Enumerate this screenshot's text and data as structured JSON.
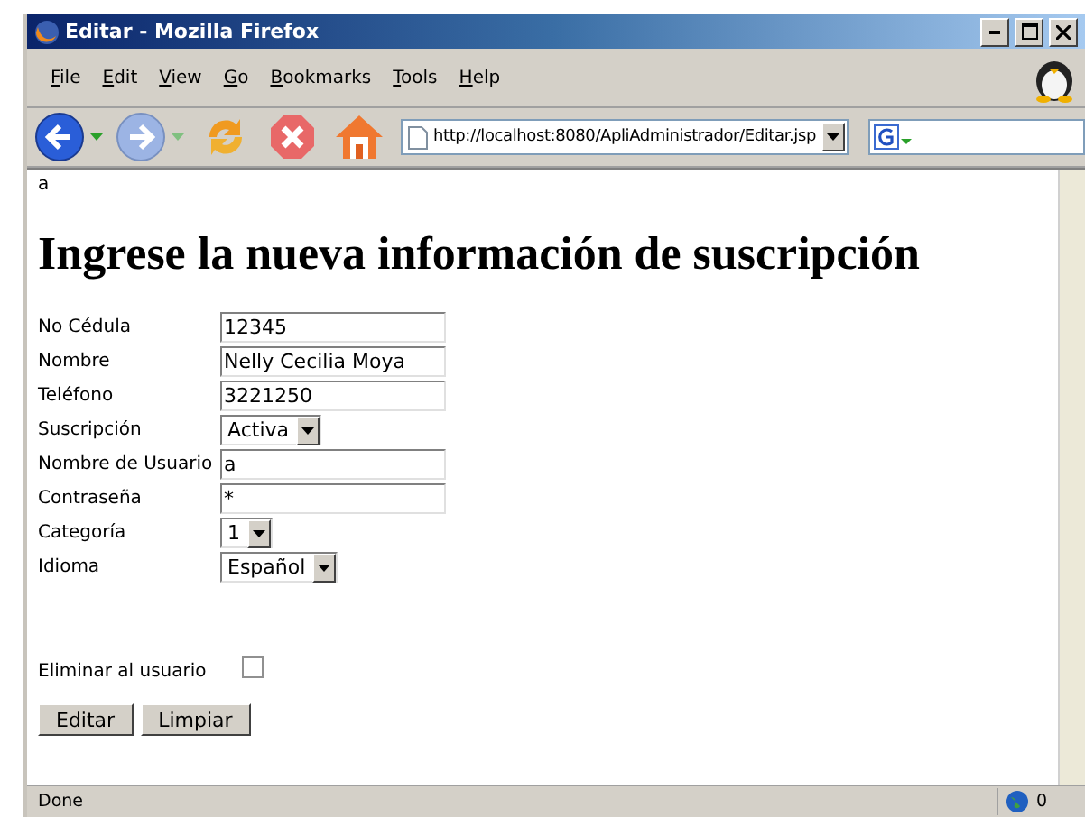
{
  "window": {
    "title": "Editar - Mozilla Firefox"
  },
  "menu": [
    "File",
    "Edit",
    "View",
    "Go",
    "Bookmarks",
    "Tools",
    "Help"
  ],
  "toolbar": {
    "url": "http://localhost:8080/ApliAdministrador/Editar.jsp"
  },
  "page": {
    "top_text": "a",
    "heading": "Ingrese la nueva información de suscripción",
    "fields": [
      {
        "label": "No Cédula",
        "kind": "text",
        "value": "12345"
      },
      {
        "label": "Nombre",
        "kind": "text",
        "value": "Nelly Cecilia Moya"
      },
      {
        "label": "Teléfono",
        "kind": "text",
        "value": "3221250"
      },
      {
        "label": "Suscripción",
        "kind": "select",
        "value": "Activa"
      },
      {
        "label": "Nombre de Usuario",
        "kind": "text",
        "value": "a"
      },
      {
        "label": "Contraseña",
        "kind": "text",
        "value": "*"
      },
      {
        "label": "Categoría",
        "kind": "select",
        "value": "1"
      },
      {
        "label": "Idioma",
        "kind": "select",
        "value": "Español"
      }
    ],
    "delete": {
      "label": "Eliminar al usuario",
      "checked": false
    },
    "buttons": [
      "Editar",
      "Limpiar"
    ]
  },
  "status_bar": {
    "text": "Done",
    "counter": "0"
  }
}
